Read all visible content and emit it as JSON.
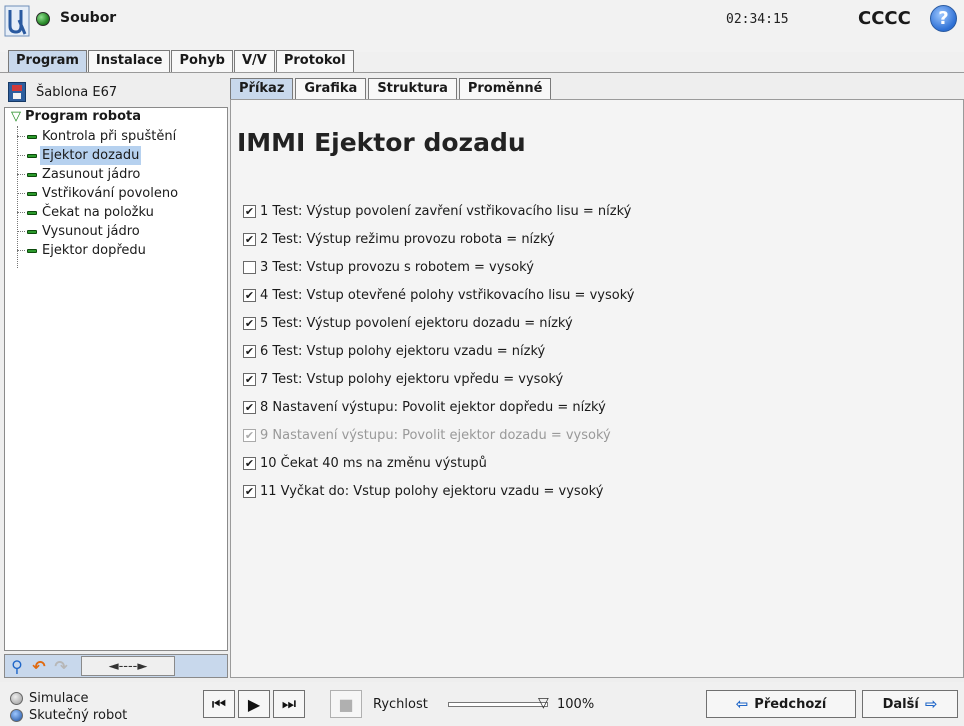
{
  "header": {
    "app_menu": "Soubor",
    "clock": "02:34:15",
    "robot_name": "CCCC",
    "help_icon": "?"
  },
  "main_tabs": [
    {
      "label": "Program",
      "active": true
    },
    {
      "label": "Instalace",
      "active": false
    },
    {
      "label": "Pohyb",
      "active": false
    },
    {
      "label": "V/V",
      "active": false
    },
    {
      "label": "Protokol",
      "active": false
    }
  ],
  "sidebar": {
    "template_label": "Šablona E67",
    "tree_root": "Program robota",
    "items": [
      {
        "label": "Kontrola při spuštění",
        "selected": false
      },
      {
        "label": "Ejektor dozadu",
        "selected": true
      },
      {
        "label": "Zasunout jádro",
        "selected": false
      },
      {
        "label": "Vstřikování povoleno",
        "selected": false
      },
      {
        "label": "Čekat na položku",
        "selected": false
      },
      {
        "label": "Vysunout jádro",
        "selected": false
      },
      {
        "label": "Ejektor dopředu",
        "selected": false
      }
    ],
    "move_label": "◄----►"
  },
  "sub_tabs": [
    {
      "label": "Příkaz",
      "active": true
    },
    {
      "label": "Grafika",
      "active": false
    },
    {
      "label": "Struktura",
      "active": false
    },
    {
      "label": "Proměnné",
      "active": false
    }
  ],
  "command": {
    "title": "IMMI Ejektor dozadu",
    "rows": [
      {
        "text": "1 Test: Výstup povolení zavření vstřikovacího lisu = nízký",
        "checked": true,
        "enabled": true
      },
      {
        "text": "2 Test: Výstup režimu provozu robota = nízký",
        "checked": true,
        "enabled": true
      },
      {
        "text": "3 Test: Vstup provozu s robotem = vysoký",
        "checked": false,
        "enabled": true
      },
      {
        "text": "4 Test: Vstup otevřené polohy vstřikovacího lisu = vysoký",
        "checked": true,
        "enabled": true
      },
      {
        "text": "5 Test: Výstup povolení ejektoru dozadu = nízký",
        "checked": true,
        "enabled": true
      },
      {
        "text": "6 Test: Vstup polohy ejektoru vzadu = nízký",
        "checked": true,
        "enabled": true
      },
      {
        "text": "7 Test: Vstup polohy ejektoru vpředu = vysoký",
        "checked": true,
        "enabled": true
      },
      {
        "text": "8 Nastavení výstupu: Povolit ejektor dopředu = nízký",
        "checked": true,
        "enabled": true
      },
      {
        "text": "9 Nastavení výstupu: Povolit ejektor dozadu = vysoký",
        "checked": true,
        "enabled": false
      },
      {
        "text": "10 Čekat 40 ms na změnu výstupů",
        "checked": true,
        "enabled": true
      },
      {
        "text": "11 Vyčkat do: Vstup polohy ejektoru vzadu = vysoký",
        "checked": true,
        "enabled": true
      }
    ]
  },
  "footer": {
    "mode_simulation": "Simulace",
    "mode_real": "Skutečný robot",
    "speed_label": "Rychlost",
    "speed_value": "100%",
    "speed_fraction": 1.0,
    "prev_label": "Předchozí",
    "next_label": "Další"
  }
}
